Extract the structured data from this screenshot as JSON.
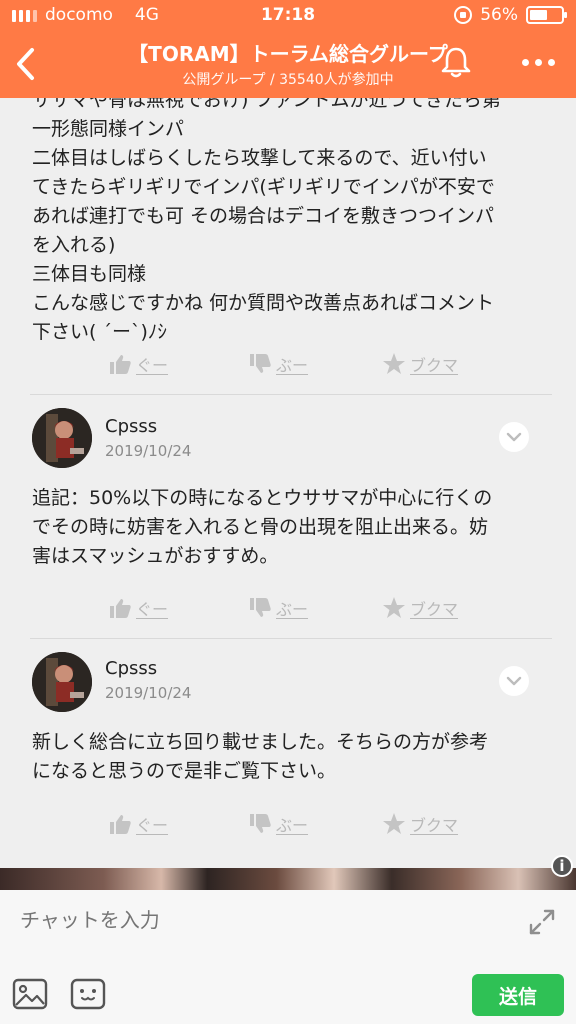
{
  "status_bar": {
    "carrier": "docomo",
    "network": "4G",
    "time": "17:18",
    "battery_text": "56%",
    "battery_level": 0.56
  },
  "nav": {
    "title": "【TORAM】トーラム総合グループ",
    "subtitle": "公開グループ / 35540人が参加中",
    "back_icon": "chevron-left-icon",
    "bell_icon": "bell-icon",
    "more_icon": "more-icon"
  },
  "previous_post": {
    "text": "ササマや骨は無視でおけ) ファントムが近づてきたら第\n一形態同様インパ\n二体目はしばらくしたら攻撃して来るので、近い付い\nてきたらギリギリでインパ(ギリギリでインパが不安で\nあれば連打でも可 その場合はデコイを敷きつつインパ\nを入れる)\n三体目も同様\nこんな感じですかね 何か質問や改善点あればコメント\n下さい( ´ー`)ﾉｼ"
  },
  "reaction_labels": {
    "good": "ぐー",
    "bad": "ぶー",
    "bookmark": "ブクマ"
  },
  "comments": [
    {
      "name": "Cpsss",
      "date": "2019/10/24",
      "body": "追記：50%以下の時になるとウササマが中心に行くの\nでその時に妨害を入れると骨の出現を阻止出来る。妨\n害はスマッシュがおすすめ。"
    },
    {
      "name": "Cpsss",
      "date": "2019/10/24",
      "body": "新しく総合に立ち回り載せました。そちらの方が参考\nになると思うので是非ご覧下さい。"
    }
  ],
  "chat": {
    "placeholder": "チャットを入力",
    "send_label": "送信"
  },
  "colors": {
    "header": "#ff7a45",
    "send": "#2fc155",
    "reaction": "#b9b9b9"
  }
}
